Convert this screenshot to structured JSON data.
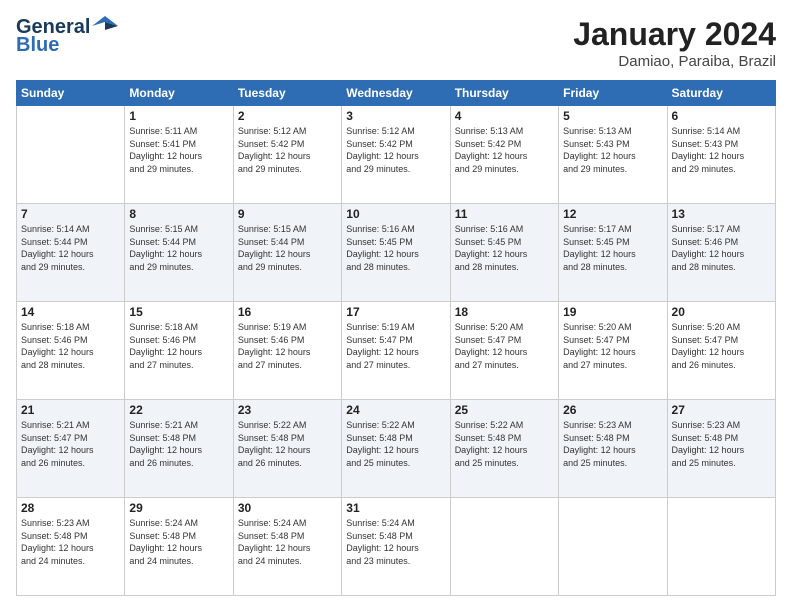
{
  "logo": {
    "line1": "General",
    "line2": "Blue"
  },
  "title": "January 2024",
  "subtitle": "Damiao, Paraiba, Brazil",
  "weekdays": [
    "Sunday",
    "Monday",
    "Tuesday",
    "Wednesday",
    "Thursday",
    "Friday",
    "Saturday"
  ],
  "weeks": [
    [
      {
        "day": "",
        "info": ""
      },
      {
        "day": "1",
        "info": "Sunrise: 5:11 AM\nSunset: 5:41 PM\nDaylight: 12 hours\nand 29 minutes."
      },
      {
        "day": "2",
        "info": "Sunrise: 5:12 AM\nSunset: 5:42 PM\nDaylight: 12 hours\nand 29 minutes."
      },
      {
        "day": "3",
        "info": "Sunrise: 5:12 AM\nSunset: 5:42 PM\nDaylight: 12 hours\nand 29 minutes."
      },
      {
        "day": "4",
        "info": "Sunrise: 5:13 AM\nSunset: 5:42 PM\nDaylight: 12 hours\nand 29 minutes."
      },
      {
        "day": "5",
        "info": "Sunrise: 5:13 AM\nSunset: 5:43 PM\nDaylight: 12 hours\nand 29 minutes."
      },
      {
        "day": "6",
        "info": "Sunrise: 5:14 AM\nSunset: 5:43 PM\nDaylight: 12 hours\nand 29 minutes."
      }
    ],
    [
      {
        "day": "7",
        "info": "Sunrise: 5:14 AM\nSunset: 5:44 PM\nDaylight: 12 hours\nand 29 minutes."
      },
      {
        "day": "8",
        "info": "Sunrise: 5:15 AM\nSunset: 5:44 PM\nDaylight: 12 hours\nand 29 minutes."
      },
      {
        "day": "9",
        "info": "Sunrise: 5:15 AM\nSunset: 5:44 PM\nDaylight: 12 hours\nand 29 minutes."
      },
      {
        "day": "10",
        "info": "Sunrise: 5:16 AM\nSunset: 5:45 PM\nDaylight: 12 hours\nand 28 minutes."
      },
      {
        "day": "11",
        "info": "Sunrise: 5:16 AM\nSunset: 5:45 PM\nDaylight: 12 hours\nand 28 minutes."
      },
      {
        "day": "12",
        "info": "Sunrise: 5:17 AM\nSunset: 5:45 PM\nDaylight: 12 hours\nand 28 minutes."
      },
      {
        "day": "13",
        "info": "Sunrise: 5:17 AM\nSunset: 5:46 PM\nDaylight: 12 hours\nand 28 minutes."
      }
    ],
    [
      {
        "day": "14",
        "info": "Sunrise: 5:18 AM\nSunset: 5:46 PM\nDaylight: 12 hours\nand 28 minutes."
      },
      {
        "day": "15",
        "info": "Sunrise: 5:18 AM\nSunset: 5:46 PM\nDaylight: 12 hours\nand 27 minutes."
      },
      {
        "day": "16",
        "info": "Sunrise: 5:19 AM\nSunset: 5:46 PM\nDaylight: 12 hours\nand 27 minutes."
      },
      {
        "day": "17",
        "info": "Sunrise: 5:19 AM\nSunset: 5:47 PM\nDaylight: 12 hours\nand 27 minutes."
      },
      {
        "day": "18",
        "info": "Sunrise: 5:20 AM\nSunset: 5:47 PM\nDaylight: 12 hours\nand 27 minutes."
      },
      {
        "day": "19",
        "info": "Sunrise: 5:20 AM\nSunset: 5:47 PM\nDaylight: 12 hours\nand 27 minutes."
      },
      {
        "day": "20",
        "info": "Sunrise: 5:20 AM\nSunset: 5:47 PM\nDaylight: 12 hours\nand 26 minutes."
      }
    ],
    [
      {
        "day": "21",
        "info": "Sunrise: 5:21 AM\nSunset: 5:47 PM\nDaylight: 12 hours\nand 26 minutes."
      },
      {
        "day": "22",
        "info": "Sunrise: 5:21 AM\nSunset: 5:48 PM\nDaylight: 12 hours\nand 26 minutes."
      },
      {
        "day": "23",
        "info": "Sunrise: 5:22 AM\nSunset: 5:48 PM\nDaylight: 12 hours\nand 26 minutes."
      },
      {
        "day": "24",
        "info": "Sunrise: 5:22 AM\nSunset: 5:48 PM\nDaylight: 12 hours\nand 25 minutes."
      },
      {
        "day": "25",
        "info": "Sunrise: 5:22 AM\nSunset: 5:48 PM\nDaylight: 12 hours\nand 25 minutes."
      },
      {
        "day": "26",
        "info": "Sunrise: 5:23 AM\nSunset: 5:48 PM\nDaylight: 12 hours\nand 25 minutes."
      },
      {
        "day": "27",
        "info": "Sunrise: 5:23 AM\nSunset: 5:48 PM\nDaylight: 12 hours\nand 25 minutes."
      }
    ],
    [
      {
        "day": "28",
        "info": "Sunrise: 5:23 AM\nSunset: 5:48 PM\nDaylight: 12 hours\nand 24 minutes."
      },
      {
        "day": "29",
        "info": "Sunrise: 5:24 AM\nSunset: 5:48 PM\nDaylight: 12 hours\nand 24 minutes."
      },
      {
        "day": "30",
        "info": "Sunrise: 5:24 AM\nSunset: 5:48 PM\nDaylight: 12 hours\nand 24 minutes."
      },
      {
        "day": "31",
        "info": "Sunrise: 5:24 AM\nSunset: 5:48 PM\nDaylight: 12 hours\nand 23 minutes."
      },
      {
        "day": "",
        "info": ""
      },
      {
        "day": "",
        "info": ""
      },
      {
        "day": "",
        "info": ""
      }
    ]
  ]
}
